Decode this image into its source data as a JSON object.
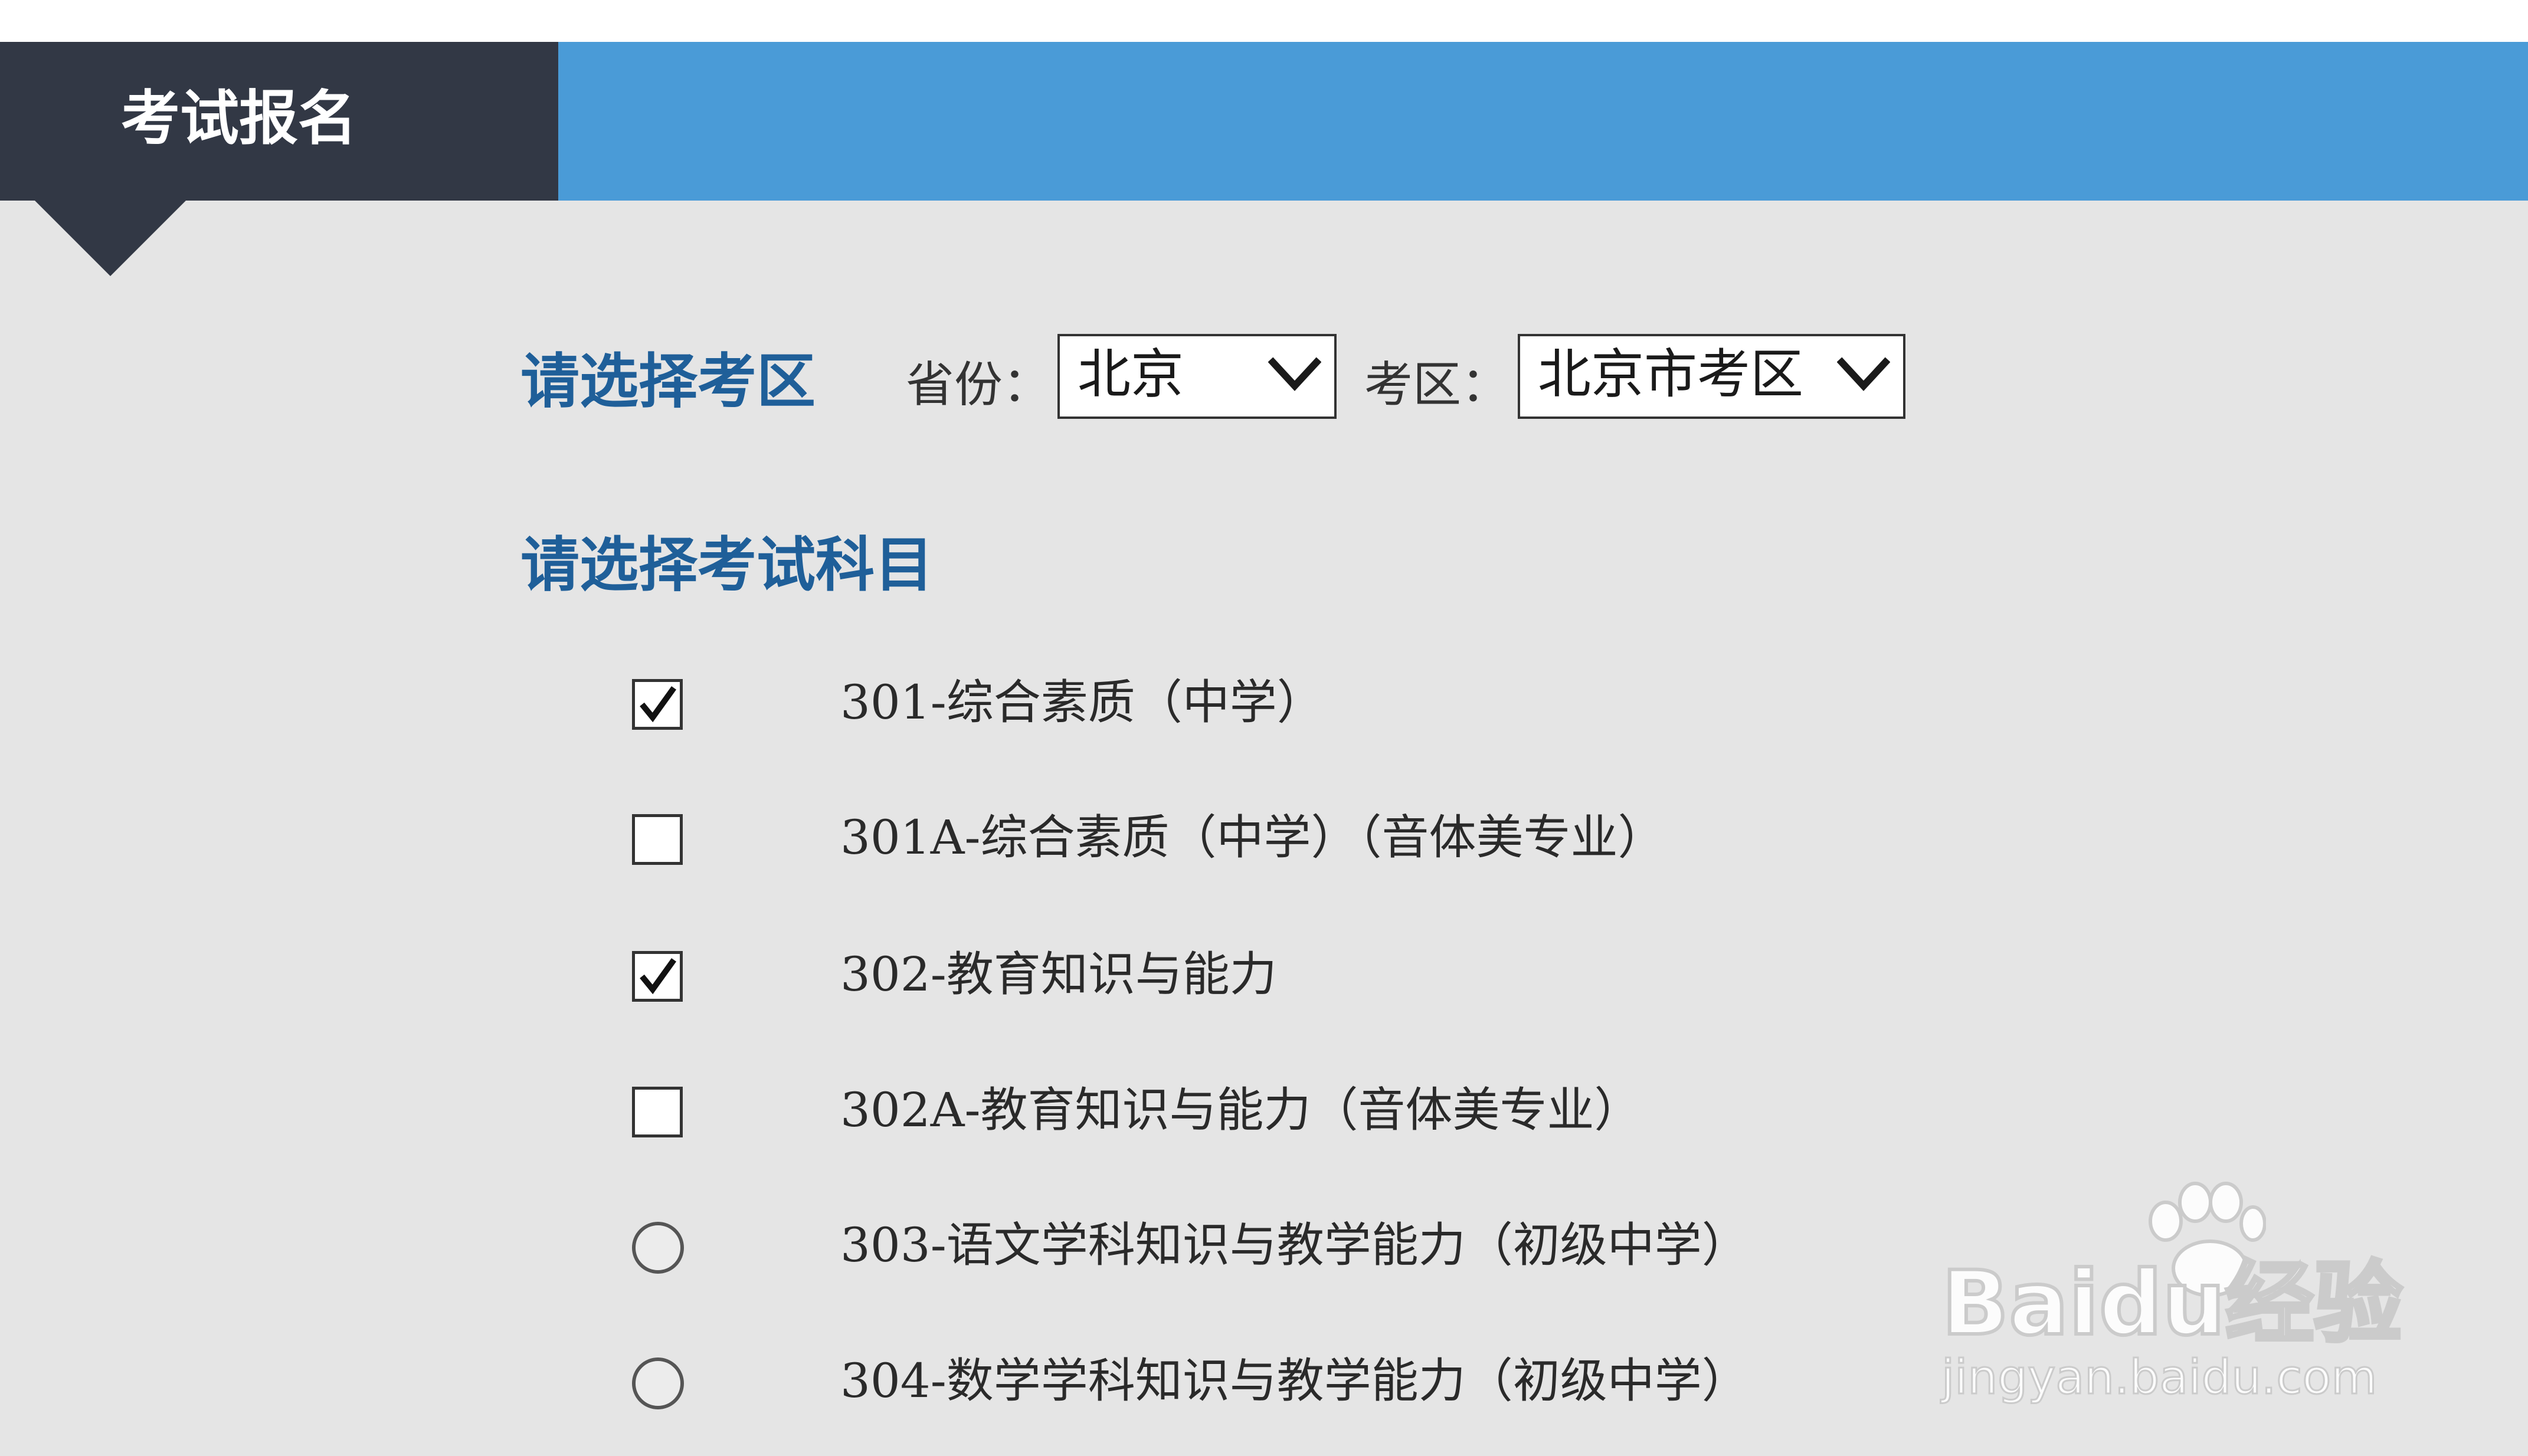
{
  "header": {
    "title": "考试报名",
    "tab_color": "#323845",
    "bar_color": "#4a9bd7"
  },
  "region": {
    "title": "请选择考区",
    "province_label": "省份：",
    "province_value": "北京",
    "district_label": "考区：",
    "district_value": "北京市考区"
  },
  "subjects": {
    "title": "请选择考试科目",
    "items": [
      {
        "label": "301-综合素质（中学）",
        "control": "checkbox",
        "checked": true
      },
      {
        "label": "301A-综合素质（中学）（音体美专业）",
        "control": "checkbox",
        "checked": false
      },
      {
        "label": "302-教育知识与能力",
        "control": "checkbox",
        "checked": true
      },
      {
        "label": "302A-教育知识与能力（音体美专业）",
        "control": "checkbox",
        "checked": false
      },
      {
        "label": "303-语文学科知识与教学能力（初级中学）",
        "control": "radio",
        "checked": false
      },
      {
        "label": "304-数学学科知识与教学能力（初级中学）",
        "control": "radio",
        "checked": false
      }
    ]
  },
  "watermark": {
    "logo": "Baidu经验",
    "url": "jingyan.baidu.com"
  },
  "colors": {
    "accent_text": "#1f5f99",
    "background": "#e5e5e5"
  }
}
